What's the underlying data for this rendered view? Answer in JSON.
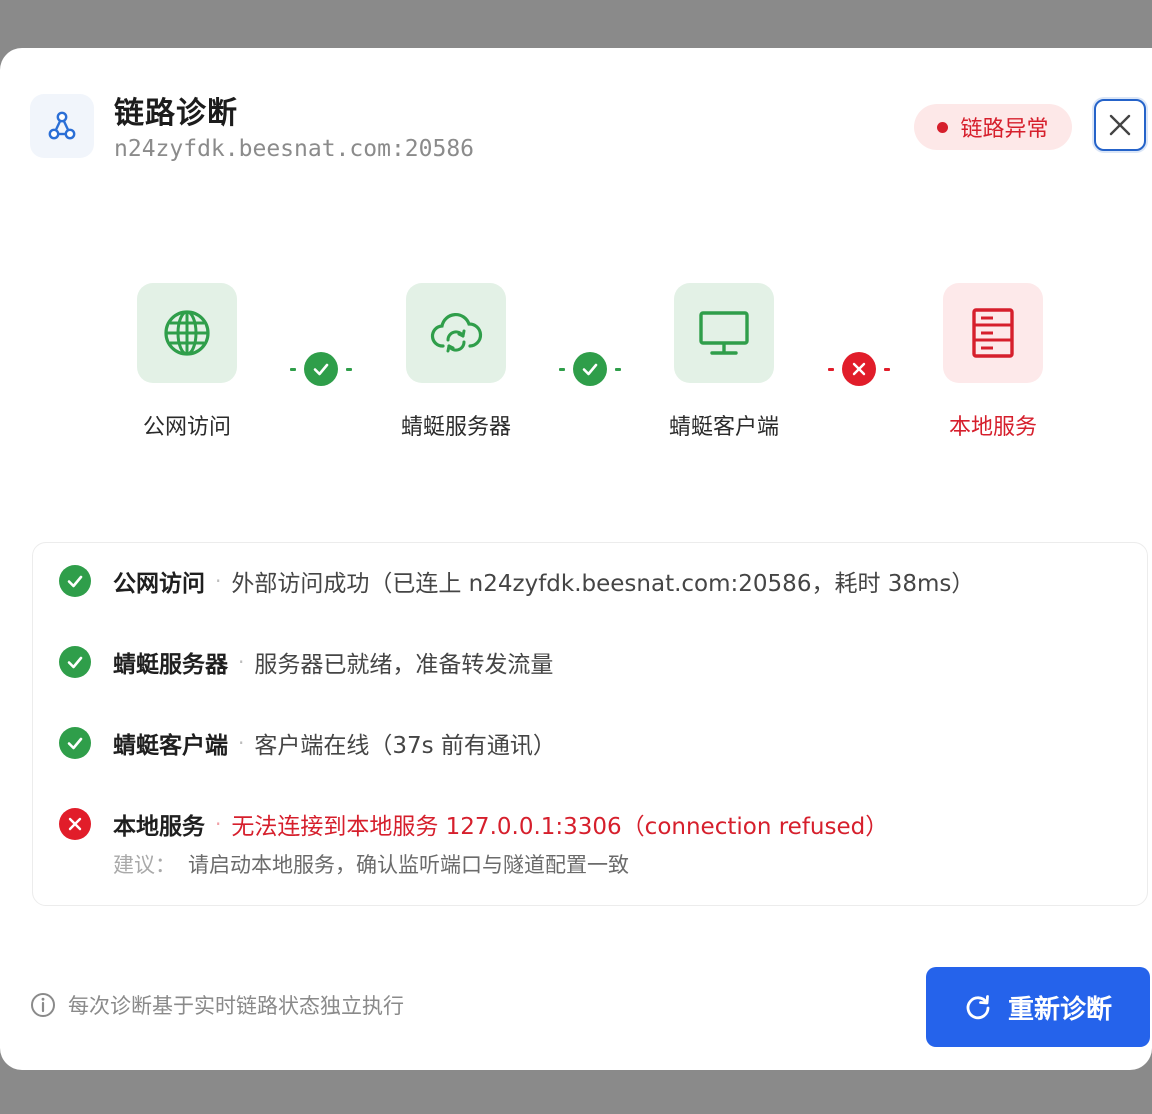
{
  "header": {
    "title": "链路诊断",
    "subtitle": "n24zyfdk.beesnat.com:20586",
    "status": "链路异常"
  },
  "flow": [
    {
      "label": "公网访问",
      "icon": "globe-icon",
      "state": "ok"
    },
    {
      "label": "蜻蜓服务器",
      "icon": "cloud-sync-icon",
      "state": "ok"
    },
    {
      "label": "蜻蜓客户端",
      "icon": "monitor-icon",
      "state": "ok"
    },
    {
      "label": "本地服务",
      "icon": "server-icon",
      "state": "error"
    }
  ],
  "checks": [
    {
      "name": "公网访问",
      "message": "外部访问成功（已连上 n24zyfdk.beesnat.com:20586，耗时 38ms）",
      "state": "ok"
    },
    {
      "name": "蜻蜓服务器",
      "message": "服务器已就绪，准备转发流量",
      "state": "ok"
    },
    {
      "name": "蜻蜓客户端",
      "message": "客户端在线（37s 前有通讯）",
      "state": "ok"
    },
    {
      "name": "本地服务",
      "message": "无法连接到本地服务 127.0.0.1:3306（connection refused）",
      "state": "error"
    }
  ],
  "suggestion": {
    "label": "建议：",
    "text": "请启动本地服务，确认监听端口与隧道配置一致"
  },
  "footer": {
    "note": "每次诊断基于实时链路状态独立执行",
    "retry_label": "重新诊断"
  },
  "colors": {
    "ok": "#2f9e4a",
    "error": "#e11d2a",
    "primary": "#2563eb"
  }
}
